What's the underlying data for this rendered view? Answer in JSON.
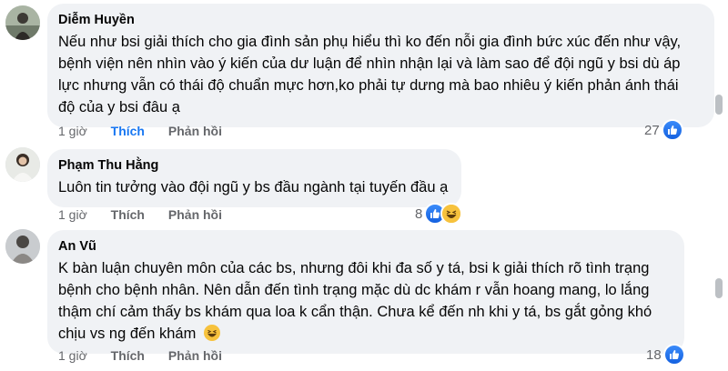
{
  "comments": [
    {
      "author": "Diễm Huyền",
      "text": "Nếu như bsi giải thích cho gia đình sản phụ hiểu thì ko đến nỗi gia đình bức xúc đến như vậy, bệnh viện nên nhìn vào ý kiến của dư luận để nhìn nhận lại và làm sao để đội ngũ y bsi dù áp lực nhưng vẫn có thái độ chuẩn mực hơn,ko phải tự dưng mà bao nhiêu ý kiến phản ánh thái độ của y bsi đâu ạ",
      "time": "1 giờ",
      "like_label": "Thích",
      "like_active": true,
      "reply_label": "Phản hồi",
      "reaction_count": "27",
      "reactions": [
        "like"
      ]
    },
    {
      "author": "Phạm Thu Hằng",
      "text": "Luôn tin tưởng vào đội ngũ y bs đầu ngành tại tuyến đầu ạ",
      "time": "1 giờ",
      "like_label": "Thích",
      "like_active": false,
      "reply_label": "Phản hồi",
      "reaction_count": "8",
      "reactions": [
        "like",
        "haha"
      ]
    },
    {
      "author": "An Vũ",
      "text": "K bàn luận chuyên môn của các bs, nhưng đôi khi đa số y tá, bsi k giải thích rõ tình trạng bệnh cho bệnh nhân. Nên dẫn đến tình trạng mặc dù dc khám r vẫn hoang mang, lo lắng thậm chí cảm thấy bs khám qua loa k cẩn thận. Chưa kể đến nh khi y tá, bs gắt gỏng khó chịu vs ng đến khám",
      "time": "1 giờ",
      "like_label": "Thích",
      "like_active": false,
      "reply_label": "Phản hồi",
      "reaction_count": "18",
      "reactions": [
        "like"
      ]
    }
  ],
  "colors": {
    "bubble": "#f0f2f5",
    "like_active": "#1877f2",
    "meta": "#65676b"
  }
}
